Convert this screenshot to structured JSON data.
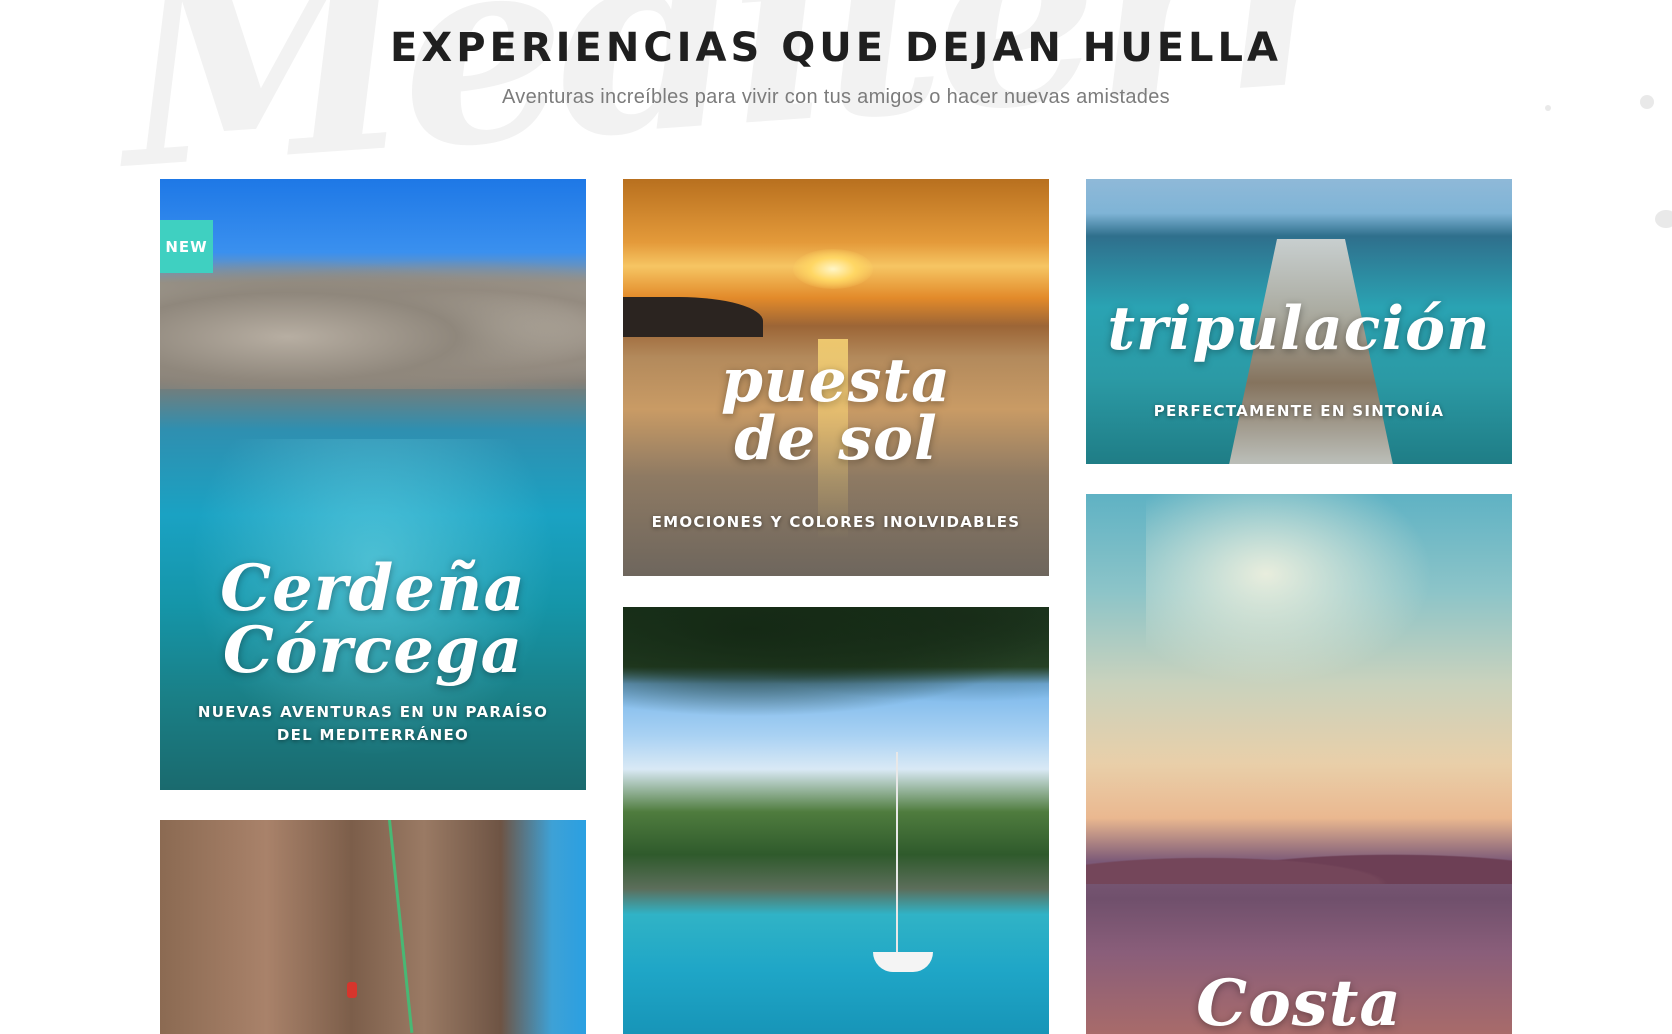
{
  "header": {
    "title": "EXPERIENCIAS QUE DEJAN HUELLA",
    "subtitle": "Aventuras increíbles para vivir con tus amigos o hacer nuevas amistades"
  },
  "colors": {
    "badge": "#3fd0c1",
    "title": "#1f1f1f",
    "subtitle": "#7c7c7c",
    "card_text": "#ffffff"
  },
  "cards": [
    {
      "badge": "NEW",
      "script_lines": [
        "Cerdeña",
        "Córcega"
      ],
      "caption": "NUEVAS AVENTURAS EN UN PARAÍSO DEL MEDITERRÁNEO"
    },
    {
      "script_lines": [
        "puesta",
        "de sol"
      ],
      "caption": "EMOCIONES Y COLORES INOLVIDABLES"
    },
    {
      "script_lines": [
        "tripulación"
      ],
      "caption": "PERFECTAMENTE EN SINTONÍA"
    },
    {
      "script_lines": [],
      "caption": ""
    },
    {
      "script_lines": [
        "Costa"
      ],
      "caption": ""
    },
    {
      "script_lines": [],
      "caption": ""
    }
  ]
}
